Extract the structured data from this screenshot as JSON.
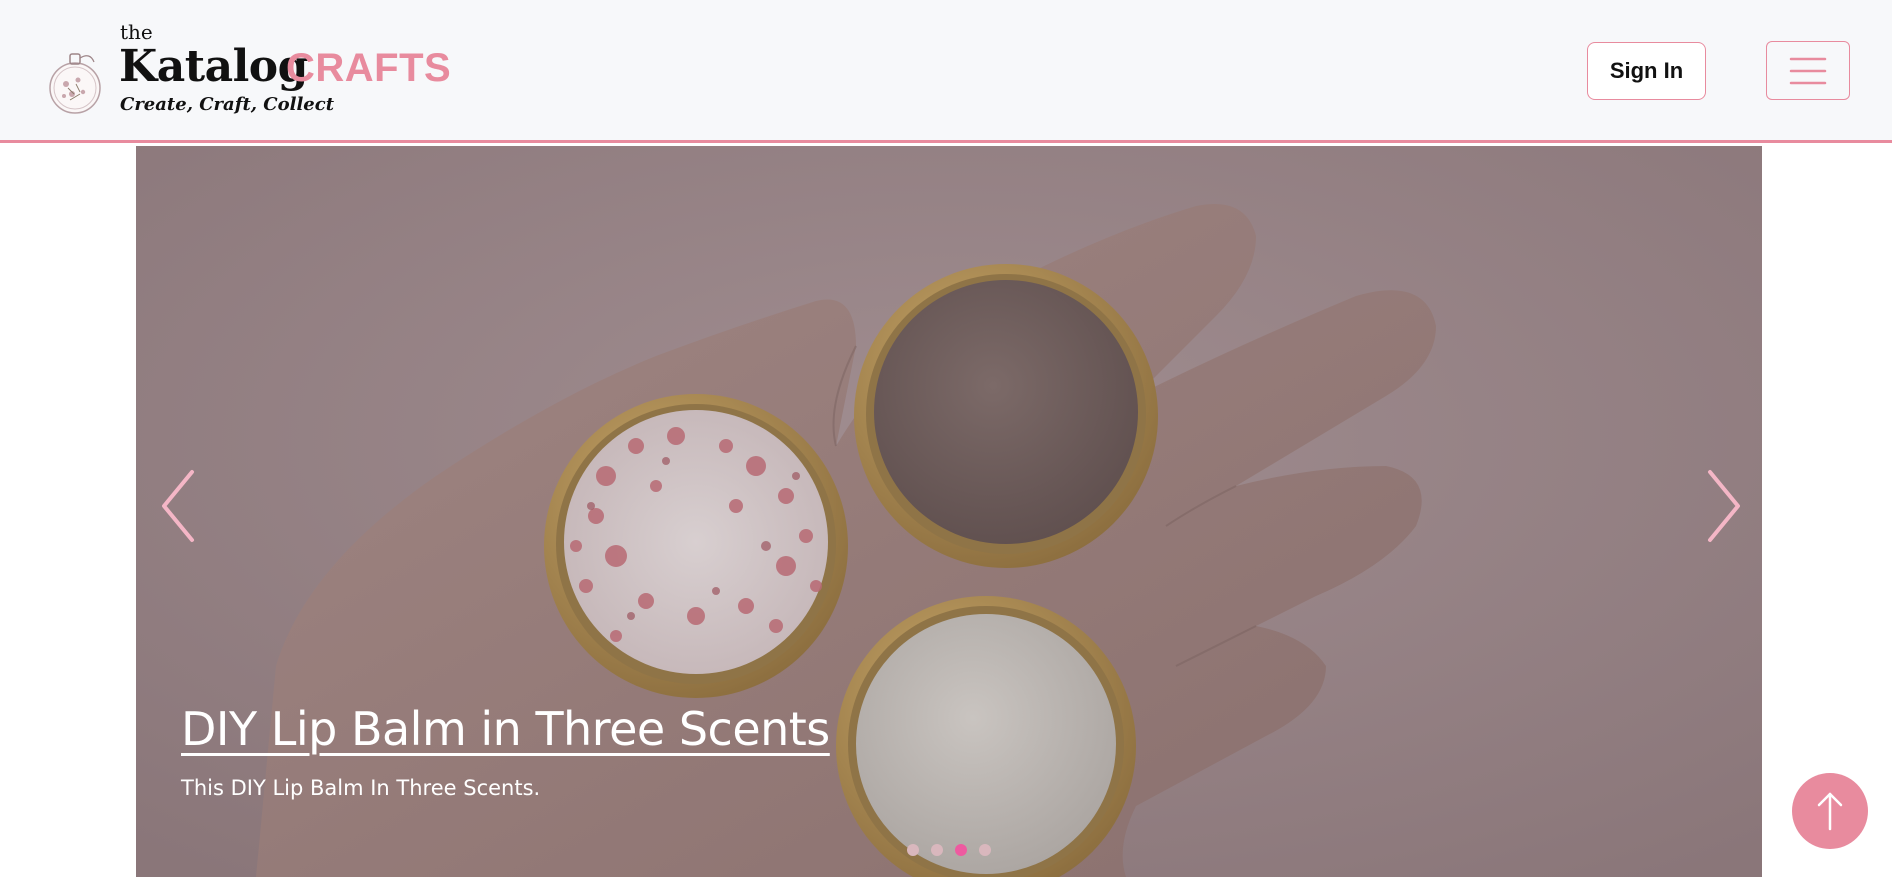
{
  "brand": {
    "the": "the",
    "name": "Katalog",
    "accent": "CRAFTS",
    "tagline": "Create, Craft, Collect",
    "icon": "embroidery-hoop-logo-icon",
    "accent_color": "#e88b9e"
  },
  "header": {
    "signin_label": "Sign In",
    "menu_icon": "hamburger-menu-icon"
  },
  "carousel": {
    "slide_title": "DIY Lip Balm in Three Scents",
    "slide_text": "This DIY Lip Balm In Three Scents.",
    "prev_icon": "chevron-left-icon",
    "next_icon": "chevron-right-icon",
    "slide_count": 4,
    "active_slide": 3,
    "active_dot_color": "#ee5aa0"
  },
  "scroll_top_icon": "arrow-up-icon"
}
